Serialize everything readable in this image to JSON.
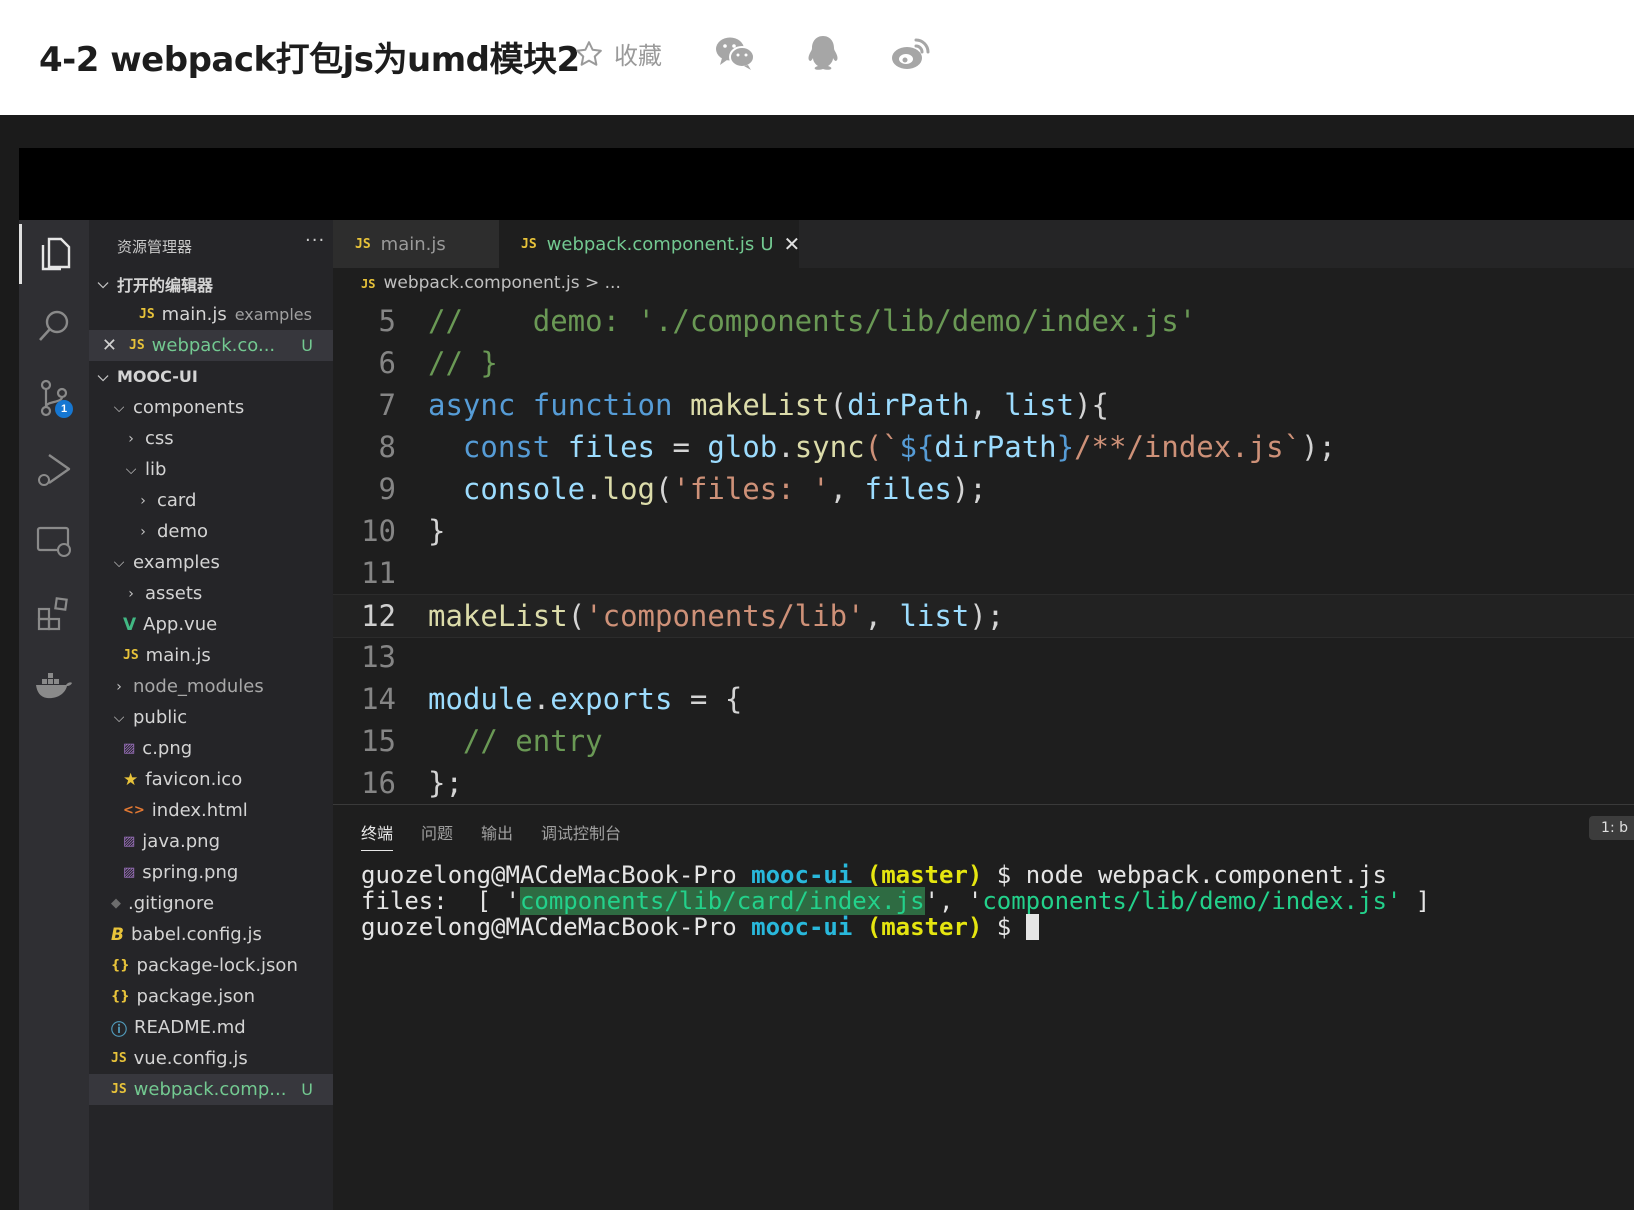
{
  "page": {
    "title": "4-2 webpack打包js为umd模块2",
    "favorite_label": "收藏"
  },
  "activity_bar": {
    "scm_badge": "1"
  },
  "explorer": {
    "title": "资源管理器",
    "more": "···",
    "open_editors_label": "打开的编辑器",
    "open_editors": [
      {
        "name": "main.js",
        "desc": "examples"
      },
      {
        "name": "webpack.co...",
        "status": "U"
      }
    ],
    "project_label": "MOOC-UI",
    "tree": {
      "components": "components",
      "css": "css",
      "lib": "lib",
      "card": "card",
      "demo": "demo",
      "examples": "examples",
      "assets": "assets",
      "app_vue": "App.vue",
      "main_js": "main.js",
      "node_modules": "node_modules",
      "public": "public",
      "c_png": "c.png",
      "favicon": "favicon.ico",
      "index_html": "index.html",
      "java_png": "java.png",
      "spring_png": "spring.png",
      "gitignore": ".gitignore",
      "babel": "babel.config.js",
      "package_lock": "package-lock.json",
      "package_json": "package.json",
      "readme": "README.md",
      "vue_config": "vue.config.js",
      "webpack_comp": "webpack.comp...",
      "webpack_status": "U"
    }
  },
  "tabs": [
    {
      "label": "main.js"
    },
    {
      "label": "webpack.component.js",
      "status": "U"
    }
  ],
  "breadcrumb": {
    "file": "webpack.component.js",
    "rest": "...",
    "sep": ">"
  },
  "code": {
    "l5": {
      "n": "5",
      "a": "//    demo: './components/lib/demo/index.js'"
    },
    "l6": {
      "n": "6",
      "a": "// }"
    },
    "l7": {
      "n": "7",
      "a": "async",
      "b": "function",
      "c": "makeList",
      "d": "(",
      "e": "dirPath",
      "f": ", ",
      "g": "list",
      "h": "){"
    },
    "l8": {
      "n": "8",
      "a": "const",
      "b": "files",
      "c": " = ",
      "d": "glob",
      "e": ".",
      "f": "sync",
      "g": "(`",
      "h": "${",
      "i": "dirPath",
      "j": "}",
      "k": "/**/index.js`",
      "l": ");"
    },
    "l9": {
      "n": "9",
      "a": "console",
      "b": ".",
      "c": "log",
      "d": "(",
      "e": "'files: '",
      "f": ", ",
      "g": "files",
      "h": ");"
    },
    "l10": {
      "n": "10",
      "a": "}"
    },
    "l11": {
      "n": "11"
    },
    "l12": {
      "n": "12",
      "a": "makeList",
      "b": "(",
      "c": "'components/lib'",
      "d": ", ",
      "e": "list",
      "f": ");"
    },
    "l13": {
      "n": "13"
    },
    "l14": {
      "n": "14",
      "a": "module",
      "b": ".",
      "c": "exports",
      "d": " = {"
    },
    "l15": {
      "n": "15",
      "a": "// entry"
    },
    "l16": {
      "n": "16",
      "a": "};"
    }
  },
  "panel": {
    "tabs": [
      "终端",
      "问题",
      "输出",
      "调试控制台"
    ],
    "terminal_select": "1: b"
  },
  "terminal": {
    "user": "guozelong@MACdeMacBook-Pro",
    "dir": "mooc-ui",
    "branch": "(master)",
    "prompt": "$",
    "command": "node webpack.component.js",
    "out_prefix": "files:  [ '",
    "out_card": "components/lib/card/index.js",
    "out_mid": "', '",
    "out_demo": "components/lib/demo/index.js'",
    "out_suffix": " ]"
  }
}
